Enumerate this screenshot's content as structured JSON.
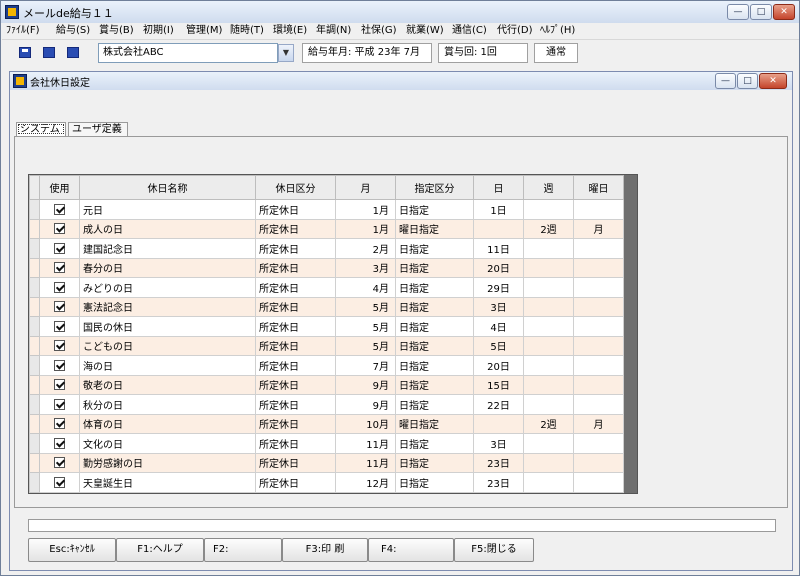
{
  "app": {
    "title": "メールde給与１１",
    "menu": [
      "ﾌｧｲﾙ(F)",
      "給与(S)",
      "賞与(B)",
      "初期(I)",
      "管理(M)",
      "随時(T)",
      "環境(E)",
      "年調(N)",
      "社保(G)",
      "就業(W)",
      "通信(C)",
      "代行(D)",
      "ﾍﾙﾌﾟ(H)"
    ],
    "window_buttons": {
      "minimize": "—",
      "maximize": "□",
      "close": "✕"
    }
  },
  "toolbar": {
    "company": "株式会社ABC",
    "pay_month": "給与年月: 平成 23年  7月",
    "bonus_count": "賞与回: 1回",
    "mode": "通常"
  },
  "child": {
    "title": "会社休日設定",
    "tabs": [
      "システム",
      "ユーザ定義"
    ]
  },
  "grid": {
    "headers": [
      "使用",
      "休日名称",
      "休日区分",
      "月",
      "指定区分",
      "日",
      "週",
      "曜日"
    ],
    "rows": [
      {
        "name": "元日",
        "kubun": "所定休日",
        "month": "1月",
        "shitei": "日指定",
        "day": "1日",
        "week": "",
        "youbi": ""
      },
      {
        "name": "成人の日",
        "kubun": "所定休日",
        "month": "1月",
        "shitei": "曜日指定",
        "day": "",
        "week": "2週",
        "youbi": "月"
      },
      {
        "name": "建国記念日",
        "kubun": "所定休日",
        "month": "2月",
        "shitei": "日指定",
        "day": "11日",
        "week": "",
        "youbi": ""
      },
      {
        "name": "春分の日",
        "kubun": "所定休日",
        "month": "3月",
        "shitei": "日指定",
        "day": "20日",
        "week": "",
        "youbi": ""
      },
      {
        "name": "みどりの日",
        "kubun": "所定休日",
        "month": "4月",
        "shitei": "日指定",
        "day": "29日",
        "week": "",
        "youbi": ""
      },
      {
        "name": "憲法記念日",
        "kubun": "所定休日",
        "month": "5月",
        "shitei": "日指定",
        "day": "3日",
        "week": "",
        "youbi": ""
      },
      {
        "name": "国民の休日",
        "kubun": "所定休日",
        "month": "5月",
        "shitei": "日指定",
        "day": "4日",
        "week": "",
        "youbi": ""
      },
      {
        "name": "こどもの日",
        "kubun": "所定休日",
        "month": "5月",
        "shitei": "日指定",
        "day": "5日",
        "week": "",
        "youbi": ""
      },
      {
        "name": "海の日",
        "kubun": "所定休日",
        "month": "7月",
        "shitei": "日指定",
        "day": "20日",
        "week": "",
        "youbi": ""
      },
      {
        "name": "敬老の日",
        "kubun": "所定休日",
        "month": "9月",
        "shitei": "日指定",
        "day": "15日",
        "week": "",
        "youbi": ""
      },
      {
        "name": "秋分の日",
        "kubun": "所定休日",
        "month": "9月",
        "shitei": "日指定",
        "day": "22日",
        "week": "",
        "youbi": ""
      },
      {
        "name": "体育の日",
        "kubun": "所定休日",
        "month": "10月",
        "shitei": "曜日指定",
        "day": "",
        "week": "2週",
        "youbi": "月"
      },
      {
        "name": "文化の日",
        "kubun": "所定休日",
        "month": "11月",
        "shitei": "日指定",
        "day": "3日",
        "week": "",
        "youbi": ""
      },
      {
        "name": "勤労感謝の日",
        "kubun": "所定休日",
        "month": "11月",
        "shitei": "日指定",
        "day": "23日",
        "week": "",
        "youbi": ""
      },
      {
        "name": "天皇誕生日",
        "kubun": "所定休日",
        "month": "12月",
        "shitei": "日指定",
        "day": "23日",
        "week": "",
        "youbi": ""
      }
    ]
  },
  "fkeys": [
    "Esc:ｷｬﾝｾﾙ",
    "F1:ヘルプ",
    "F2:",
    "F3:印  刷",
    "F4:",
    "F5:閉じる"
  ],
  "colors": {
    "alt_row": "#fceee3",
    "grid_bg": "#6f6f6f",
    "titlebar": "#dbe6f4"
  }
}
